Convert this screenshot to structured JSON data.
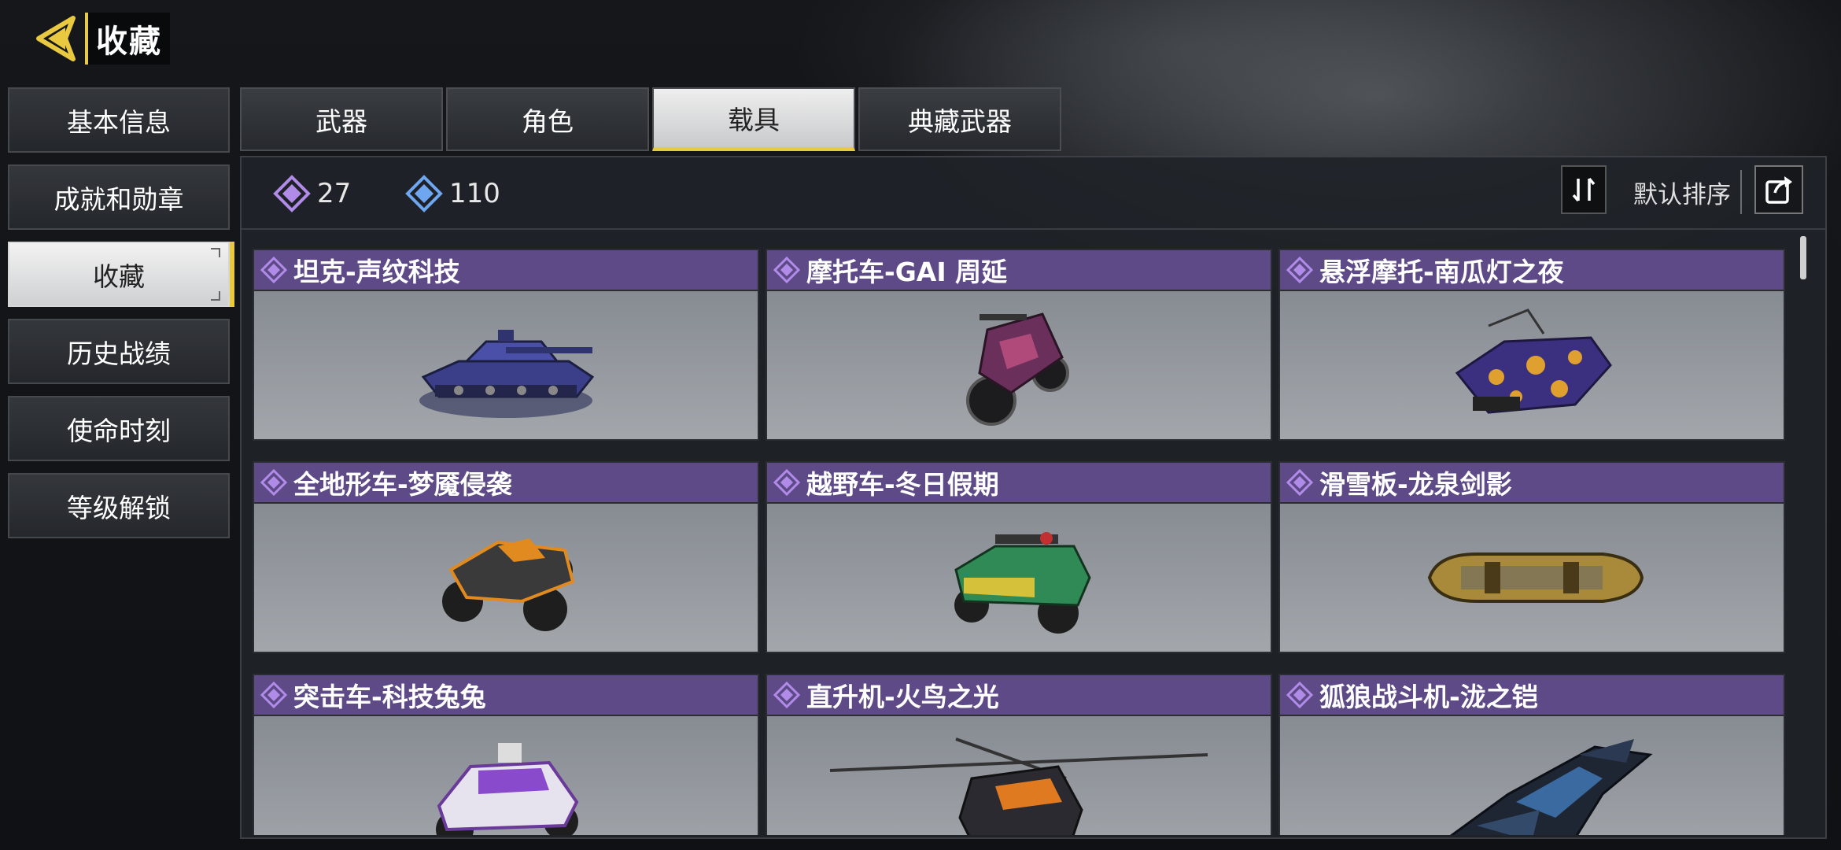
{
  "header": {
    "title": "收藏"
  },
  "sidebar": {
    "items": [
      {
        "label": "基本信息"
      },
      {
        "label": "成就和勋章"
      },
      {
        "label": "收藏"
      },
      {
        "label": "历史战绩"
      },
      {
        "label": "使命时刻"
      },
      {
        "label": "等级解锁"
      }
    ],
    "active_index": 2
  },
  "tabs": [
    {
      "label": "武器"
    },
    {
      "label": "角色"
    },
    {
      "label": "载具"
    },
    {
      "label": "典藏武器"
    }
  ],
  "stats": {
    "purple_count": "27",
    "blue_count": "110"
  },
  "sort": {
    "label": "默认排序"
  },
  "cards": [
    {
      "title": "坦克-声纹科技",
      "icon": "tank-icon"
    },
    {
      "title": "摩托车-GAI 周延",
      "icon": "motorcycle-icon"
    },
    {
      "title": "悬浮摩托-南瓜灯之夜",
      "icon": "hover-bike-icon"
    },
    {
      "title": "全地形车-梦魇侵袭",
      "icon": "atv-icon"
    },
    {
      "title": "越野车-冬日假期",
      "icon": "offroad-car-icon"
    },
    {
      "title": "滑雪板-龙泉剑影",
      "icon": "snowboard-icon"
    },
    {
      "title": "突击车-科技兔兔",
      "icon": "assault-car-icon"
    },
    {
      "title": "直升机-火鸟之光",
      "icon": "helicopter-icon"
    },
    {
      "title": "狐狼战斗机-泷之铠",
      "icon": "fighter-jet-icon"
    }
  ],
  "colors": {
    "accent_yellow": "#e8c93f",
    "card_header_purple": "#5d4a87",
    "purple_rarity": "#b08be8",
    "blue_rarity": "#6fa6f0"
  }
}
